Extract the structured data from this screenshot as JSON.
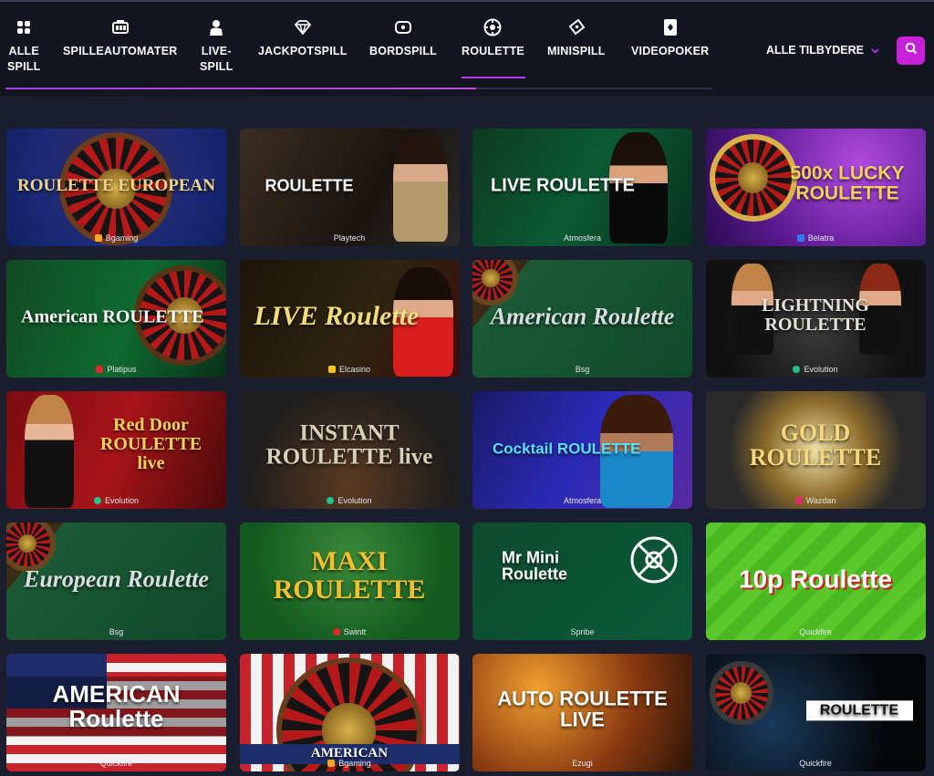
{
  "nav": {
    "items": [
      {
        "label": "ALLE\nSPILL",
        "icon": "grid-icon"
      },
      {
        "label": "SPILLEAUTOMATER",
        "icon": "slot-machine-icon"
      },
      {
        "label": "LIVE-\nSPILL",
        "icon": "dealer-icon"
      },
      {
        "label": "JACKPOTSPILL",
        "icon": "diamond-icon"
      },
      {
        "label": "BORDSPILL",
        "icon": "table-icon"
      },
      {
        "label": "ROULETTE",
        "icon": "roulette-icon"
      },
      {
        "label": "MINISPILL",
        "icon": "ticket-icon"
      },
      {
        "label": "VIDEOPOKER",
        "icon": "card-icon"
      }
    ],
    "active": "ROULETTE",
    "providers_label": "ALLE TILBYDERE"
  },
  "colors": {
    "accent": "#c81fd8",
    "active_line": "#b43cf0",
    "background": "#1b1e2e",
    "topbar": "#131521"
  },
  "games": [
    {
      "title": "ROULETTE EUROPEAN",
      "provider": "Bgaming"
    },
    {
      "title": "ROULETTE",
      "provider": "Playtech"
    },
    {
      "title": "LIVE ROULETTE",
      "provider": "Atmosfera"
    },
    {
      "title": "500x LUCKY ROULETTE",
      "provider": "Belatra"
    },
    {
      "title": "American ROULETTE",
      "provider": "Platipus"
    },
    {
      "title": "LIVE Roulette",
      "provider": "Elcasino"
    },
    {
      "title": "American Roulette",
      "provider": "Bsg"
    },
    {
      "title": "LIGHTNING ROULETTE",
      "provider": "Evolution"
    },
    {
      "title": "Red Door ROULETTE live",
      "provider": "Evolution"
    },
    {
      "title": "INSTANT ROULETTE live",
      "provider": "Evolution"
    },
    {
      "title": "Cocktail ROULETTE",
      "provider": "Atmosfera"
    },
    {
      "title": "GOLD ROULETTE",
      "provider": "Wazdan"
    },
    {
      "title": "European Roulette",
      "provider": "Bsg"
    },
    {
      "title": "MAXI ROULETTE",
      "provider": "Swintt"
    },
    {
      "title": "Mr Mini Roulette",
      "provider": "Spribe"
    },
    {
      "title": "10p Roulette",
      "provider": "Quickfire"
    },
    {
      "title": "AMERICAN Roulette",
      "provider": "Quickfire"
    },
    {
      "title": "AMERICAN",
      "provider": "Bgaming"
    },
    {
      "title": "AUTO ROULETTE LIVE",
      "provider": "Ezugi"
    },
    {
      "title": "ROULETTE",
      "provider": "Quickfire"
    }
  ]
}
